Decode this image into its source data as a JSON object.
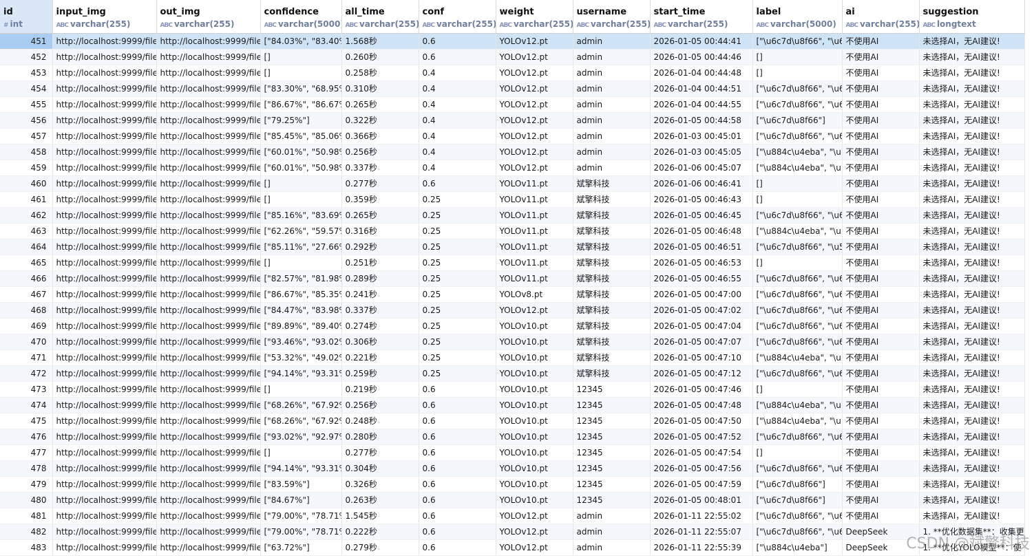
{
  "columns": [
    {
      "name": "id",
      "type": "int",
      "icon": "#"
    },
    {
      "name": "input_img",
      "type": "varchar(255)",
      "icon": "ABC"
    },
    {
      "name": "out_img",
      "type": "varchar(255)",
      "icon": "ABC"
    },
    {
      "name": "confidence",
      "type": "varchar(5000)",
      "icon": "ABC"
    },
    {
      "name": "all_time",
      "type": "varchar(255)",
      "icon": "ABC"
    },
    {
      "name": "conf",
      "type": "varchar(255)",
      "icon": "ABC"
    },
    {
      "name": "weight",
      "type": "varchar(255)",
      "icon": "ABC"
    },
    {
      "name": "username",
      "type": "varchar(255)",
      "icon": "ABC"
    },
    {
      "name": "start_time",
      "type": "varchar(255)",
      "icon": "ABC"
    },
    {
      "name": "label",
      "type": "varchar(5000)",
      "icon": "ABC"
    },
    {
      "name": "ai",
      "type": "varchar(255)",
      "icon": "ABC"
    },
    {
      "name": "suggestion",
      "type": "longtext",
      "icon": "ABC"
    }
  ],
  "selected_row_id": "451",
  "rows": [
    [
      "451",
      "http://localhost:9999/file",
      "http://localhost:9999/file",
      "[\"84.03%\", \"83.40%",
      "1.568秒",
      "0.6",
      "YOLOv12.pt",
      "admin",
      "2026-01-05 00:44:41",
      "[\"\\u6c7d\\u8f66\", \"\\u6",
      "不使用AI",
      "未选择AI，无AI建议!"
    ],
    [
      "452",
      "http://localhost:9999/file",
      "http://localhost:9999/file",
      "[]",
      "0.260秒",
      "0.6",
      "YOLOv12.pt",
      "admin",
      "2026-01-05 00:44:46",
      "[]",
      "不使用AI",
      "未选择AI，无AI建议!"
    ],
    [
      "453",
      "http://localhost:9999/file",
      "http://localhost:9999/file",
      "[]",
      "0.258秒",
      "0.4",
      "YOLOv12.pt",
      "admin",
      "2026-01-04 00:44:48",
      "[]",
      "不使用AI",
      "未选择AI，无AI建议!"
    ],
    [
      "454",
      "http://localhost:9999/file",
      "http://localhost:9999/file",
      "[\"83.30%\", \"68.95%",
      "0.310秒",
      "0.4",
      "YOLOv12.pt",
      "admin",
      "2026-01-04 00:44:51",
      "[\"\\u6c7d\\u8f66\", \"\\u6",
      "不使用AI",
      "未选择AI，无AI建议!"
    ],
    [
      "455",
      "http://localhost:9999/file",
      "http://localhost:9999/file",
      "[\"86.67%\", \"86.67%",
      "0.265秒",
      "0.4",
      "YOLOv12.pt",
      "admin",
      "2026-01-04 00:44:55",
      "[\"\\u6c7d\\u8f66\", \"\\u6",
      "不使用AI",
      "未选择AI，无AI建议!"
    ],
    [
      "456",
      "http://localhost:9999/file",
      "http://localhost:9999/file",
      "[\"79.25%\"]",
      "0.322秒",
      "0.4",
      "YOLOv12.pt",
      "admin",
      "2026-01-05 00:44:58",
      "[\"\\u6c7d\\u8f66\"]",
      "不使用AI",
      "未选择AI，无AI建议!"
    ],
    [
      "457",
      "http://localhost:9999/file",
      "http://localhost:9999/file",
      "[\"85.45%\", \"85.06%",
      "0.366秒",
      "0.4",
      "YOLOv12.pt",
      "admin",
      "2026-01-03 00:45:01",
      "[\"\\u6c7d\\u8f66\", \"\\u6",
      "不使用AI",
      "未选择AI，无AI建议!"
    ],
    [
      "458",
      "http://localhost:9999/file",
      "http://localhost:9999/file",
      "[\"60.01%\", \"50.98%",
      "0.256秒",
      "0.4",
      "YOLOv12.pt",
      "admin",
      "2026-01-03 00:45:05",
      "[\"\\u884c\\u4eba\", \"\\u",
      "不使用AI",
      "未选择AI，无AI建议!"
    ],
    [
      "459",
      "http://localhost:9999/file",
      "http://localhost:9999/file",
      "[\"60.01%\", \"50.98%",
      "0.337秒",
      "0.4",
      "YOLOv12.pt",
      "admin",
      "2026-01-06 00:45:07",
      "[\"\\u884c\\u4eba\", \"\\u",
      "不使用AI",
      "未选择AI，无AI建议!"
    ],
    [
      "460",
      "http://localhost:9999/file",
      "http://localhost:9999/file",
      "[]",
      "0.277秒",
      "0.6",
      "YOLOv11.pt",
      "斌擎科技",
      "2026-01-06 00:46:41",
      "[]",
      "不使用AI",
      "未选择AI，无AI建议!"
    ],
    [
      "461",
      "http://localhost:9999/file",
      "http://localhost:9999/file",
      "[]",
      "0.359秒",
      "0.25",
      "YOLOv11.pt",
      "斌擎科技",
      "2026-01-05 00:46:43",
      "[]",
      "不使用AI",
      "未选择AI，无AI建议!"
    ],
    [
      "462",
      "http://localhost:9999/file",
      "http://localhost:9999/file",
      "[\"85.16%\", \"83.69%",
      "0.265秒",
      "0.25",
      "YOLOv11.pt",
      "斌擎科技",
      "2026-01-05 00:46:45",
      "[\"\\u6c7d\\u8f66\", \"\\u6",
      "不使用AI",
      "未选择AI，无AI建议!"
    ],
    [
      "463",
      "http://localhost:9999/file",
      "http://localhost:9999/file",
      "[\"62.26%\", \"59.57%",
      "0.316秒",
      "0.25",
      "YOLOv11.pt",
      "斌擎科技",
      "2026-01-05 00:46:48",
      "[\"\\u884c\\u4eba\", \"\\u",
      "不使用AI",
      "未选择AI，无AI建议!"
    ],
    [
      "464",
      "http://localhost:9999/file",
      "http://localhost:9999/file",
      "[\"85.11%\", \"27.66%",
      "0.292秒",
      "0.25",
      "YOLOv11.pt",
      "斌擎科技",
      "2026-01-05 00:46:51",
      "[\"\\u6c7d\\u8f66\", \"\\u5",
      "不使用AI",
      "未选择AI，无AI建议!"
    ],
    [
      "465",
      "http://localhost:9999/file",
      "http://localhost:9999/file",
      "[]",
      "0.251秒",
      "0.25",
      "YOLOv11.pt",
      "斌擎科技",
      "2026-01-05 00:46:53",
      "[]",
      "不使用AI",
      "未选择AI，无AI建议!"
    ],
    [
      "466",
      "http://localhost:9999/file",
      "http://localhost:9999/file",
      "[\"82.57%\", \"81.98%",
      "0.289秒",
      "0.25",
      "YOLOv11.pt",
      "斌擎科技",
      "2026-01-05 00:46:55",
      "[\"\\u6c7d\\u8f66\", \"\\u6",
      "不使用AI",
      "未选择AI，无AI建议!"
    ],
    [
      "467",
      "http://localhost:9999/file",
      "http://localhost:9999/file",
      "[\"86.67%\", \"85.35%",
      "0.241秒",
      "0.25",
      "YOLOv8.pt",
      "斌擎科技",
      "2026-01-05 00:47:00",
      "[\"\\u6c7d\\u8f66\", \"\\u6",
      "不使用AI",
      "未选择AI，无AI建议!"
    ],
    [
      "468",
      "http://localhost:9999/file",
      "http://localhost:9999/file",
      "[\"84.47%\", \"83.98%",
      "0.337秒",
      "0.25",
      "YOLOv12.pt",
      "斌擎科技",
      "2026-01-05 00:47:02",
      "[\"\\u6c7d\\u8f66\", \"\\u6",
      "不使用AI",
      "未选择AI，无AI建议!"
    ],
    [
      "469",
      "http://localhost:9999/file",
      "http://localhost:9999/file",
      "[\"89.89%\", \"89.40%",
      "0.274秒",
      "0.25",
      "YOLOv10.pt",
      "斌擎科技",
      "2026-01-05 00:47:04",
      "[\"\\u6c7d\\u8f66\", \"\\u6",
      "不使用AI",
      "未选择AI，无AI建议!"
    ],
    [
      "470",
      "http://localhost:9999/file",
      "http://localhost:9999/file",
      "[\"93.46%\", \"93.02%",
      "0.306秒",
      "0.25",
      "YOLOv10.pt",
      "斌擎科技",
      "2026-01-05 00:47:07",
      "[\"\\u6c7d\\u8f66\", \"\\u6",
      "不使用AI",
      "未选择AI，无AI建议!"
    ],
    [
      "471",
      "http://localhost:9999/file",
      "http://localhost:9999/file",
      "[\"53.32%\", \"49.02%",
      "0.221秒",
      "0.25",
      "YOLOv10.pt",
      "斌擎科技",
      "2026-01-05 00:47:10",
      "[\"\\u884c\\u4eba\", \"\\u",
      "不使用AI",
      "未选择AI，无AI建议!"
    ],
    [
      "472",
      "http://localhost:9999/file",
      "http://localhost:9999/file",
      "[\"94.14%\", \"93.31%",
      "0.259秒",
      "0.25",
      "YOLOv10.pt",
      "斌擎科技",
      "2026-01-05 00:47:12",
      "[\"\\u6c7d\\u8f66\", \"\\u6",
      "不使用AI",
      "未选择AI，无AI建议!"
    ],
    [
      "473",
      "http://localhost:9999/file",
      "http://localhost:9999/file",
      "[]",
      "0.219秒",
      "0.6",
      "YOLOv10.pt",
      "12345",
      "2026-01-05 00:47:46",
      "[]",
      "不使用AI",
      "未选择AI，无AI建议!"
    ],
    [
      "474",
      "http://localhost:9999/file",
      "http://localhost:9999/file",
      "[\"68.26%\", \"67.92%",
      "0.256秒",
      "0.6",
      "YOLOv10.pt",
      "12345",
      "2026-01-05 00:47:48",
      "[\"\\u884c\\u4eba\", \"\\u",
      "不使用AI",
      "未选择AI，无AI建议!"
    ],
    [
      "475",
      "http://localhost:9999/file",
      "http://localhost:9999/file",
      "[\"68.26%\", \"67.92%",
      "0.248秒",
      "0.6",
      "YOLOv10.pt",
      "12345",
      "2026-01-05 00:47:50",
      "[\"\\u884c\\u4eba\", \"\\u",
      "不使用AI",
      "未选择AI，无AI建议!"
    ],
    [
      "476",
      "http://localhost:9999/file",
      "http://localhost:9999/file",
      "[\"93.02%\", \"92.97%",
      "0.280秒",
      "0.6",
      "YOLOv10.pt",
      "12345",
      "2026-01-05 00:47:52",
      "[\"\\u6c7d\\u8f66\", \"\\u6",
      "不使用AI",
      "未选择AI，无AI建议!"
    ],
    [
      "477",
      "http://localhost:9999/file",
      "http://localhost:9999/file",
      "[]",
      "0.277秒",
      "0.6",
      "YOLOv10.pt",
      "12345",
      "2026-01-05 00:47:54",
      "[]",
      "不使用AI",
      "未选择AI，无AI建议!"
    ],
    [
      "478",
      "http://localhost:9999/file",
      "http://localhost:9999/file",
      "[\"94.14%\", \"93.31%",
      "0.304秒",
      "0.6",
      "YOLOv10.pt",
      "12345",
      "2026-01-05 00:47:56",
      "[\"\\u6c7d\\u8f66\", \"\\u6",
      "不使用AI",
      "未选择AI，无AI建议!"
    ],
    [
      "479",
      "http://localhost:9999/file",
      "http://localhost:9999/file",
      "[\"83.59%\"]",
      "0.326秒",
      "0.6",
      "YOLOv10.pt",
      "12345",
      "2026-01-05 00:47:59",
      "[\"\\u6c7d\\u8f66\"]",
      "不使用AI",
      "未选择AI，无AI建议!"
    ],
    [
      "480",
      "http://localhost:9999/file",
      "http://localhost:9999/file",
      "[\"84.67%\"]",
      "0.263秒",
      "0.6",
      "YOLOv10.pt",
      "12345",
      "2026-01-05 00:48:01",
      "[\"\\u6c7d\\u8f66\"]",
      "不使用AI",
      "未选择AI，无AI建议!"
    ],
    [
      "481",
      "http://localhost:9999/file",
      "http://localhost:9999/file",
      "[\"79.00%\", \"78.71%",
      "1.545秒",
      "0.6",
      "YOLOv12.pt",
      "admin",
      "2026-01-11 22:55:02",
      "[\"\\u6c7d\\u8f66\", \"\\u6",
      "不使用AI",
      "未选择AI，无AI建议!"
    ],
    [
      "482",
      "http://localhost:9999/file",
      "http://localhost:9999/file",
      "[\"79.00%\", \"78.71%",
      "0.222秒",
      "0.6",
      "YOLOv12.pt",
      "admin",
      "2026-01-11 22:55:07",
      "[\"\\u6c7d\\u8f66\", \"\\u6",
      "DeepSeek",
      "1. **优化数据集**：收集更"
    ],
    [
      "483",
      "http://localhost:9999/file",
      "http://localhost:9999/file",
      "[\"63.72%\"]",
      "0.279秒",
      "0.6",
      "YOLOv12.pt",
      "admin",
      "2026-01-11 22:55:39",
      "[\"\\u884c\\u4eba\"]",
      "DeepSeek",
      "1. **优化YOLO模型**：使"
    ]
  ],
  "watermark": "CSDN @斌擎科技"
}
